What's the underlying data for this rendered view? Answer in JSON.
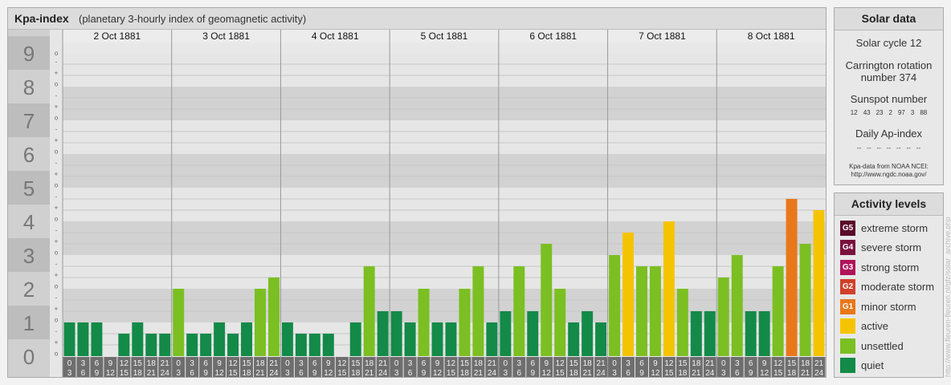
{
  "header": {
    "title": "Kpa-index",
    "subtitle": "(planetary 3-hourly index of geomagnetic activity)"
  },
  "chart_data": {
    "type": "bar",
    "title": "Kpa-index",
    "subtitle": "(planetary 3-hourly index of geomagnetic activity)",
    "ylim": [
      0,
      9
    ],
    "y_ticks": [
      "0",
      "1",
      "2",
      "3",
      "4",
      "5",
      "6",
      "7",
      "8",
      "9"
    ],
    "y_subticks": [
      "o",
      "+",
      "-"
    ],
    "days": [
      "2 Oct 1881",
      "3 Oct 1881",
      "4 Oct 1881",
      "5 Oct 1881",
      "6 Oct 1881",
      "7 Oct 1881",
      "8 Oct 1881"
    ],
    "interval_start": [
      "0",
      "3",
      "6",
      "9",
      "12",
      "15",
      "18",
      "21"
    ],
    "interval_end": [
      "3",
      "6",
      "9",
      "12",
      "15",
      "18",
      "21",
      "24"
    ],
    "values": [
      [
        1.0,
        1.0,
        1.0,
        0.0,
        0.667,
        1.0,
        0.667,
        0.667
      ],
      [
        2.0,
        0.667,
        0.667,
        1.0,
        0.667,
        1.0,
        2.0,
        2.333
      ],
      [
        1.0,
        0.667,
        0.667,
        0.667,
        0.0,
        1.0,
        2.667,
        1.333
      ],
      [
        1.333,
        1.0,
        2.0,
        1.0,
        1.0,
        2.0,
        2.667,
        1.0
      ],
      [
        1.333,
        2.667,
        1.333,
        3.333,
        2.0,
        1.0,
        1.333,
        1.0
      ],
      [
        3.0,
        3.667,
        2.667,
        2.667,
        4.0,
        2.0,
        1.333,
        1.333
      ],
      [
        2.333,
        3.0,
        1.333,
        1.333,
        2.667,
        4.667,
        3.333,
        4.333
      ]
    ]
  },
  "solar_data": {
    "title": "Solar data",
    "solar_cycle": "Solar cycle 12",
    "carrington_line1": "Carrington rotation",
    "carrington_line2": "number 374",
    "sunspot_label": "Sunspot number",
    "sunspot_values": [
      "12",
      "43",
      "23",
      "2",
      "97",
      "3",
      "88"
    ],
    "ap_label": "Daily Ap-index",
    "ap_values": [
      "--",
      "--",
      "--",
      "--",
      "--",
      "--",
      "--"
    ],
    "source_line1": "Kpa-data from NOAA NCEI:",
    "source_line2": "http://www.ngdc.noaa.gov/"
  },
  "activity_levels": {
    "title": "Activity levels",
    "items": [
      {
        "code": "G5",
        "label": "extreme storm",
        "color": "#5a0a2a"
      },
      {
        "code": "G4",
        "label": "severe storm",
        "color": "#7a1040"
      },
      {
        "code": "G3",
        "label": "strong storm",
        "color": "#b0135b"
      },
      {
        "code": "G2",
        "label": "moderate storm",
        "color": "#d0402a"
      },
      {
        "code": "G1",
        "label": "minor storm",
        "color": "#e8781a"
      },
      {
        "code": "",
        "label": "active",
        "color": "#f5c400"
      },
      {
        "code": "",
        "label": "unsettled",
        "color": "#7bbf22"
      },
      {
        "code": "",
        "label": "quiet",
        "color": "#138a48"
      }
    ]
  },
  "watermark": "http://www.fleuren-fleuren.nl/gfz/solar_archive.php"
}
